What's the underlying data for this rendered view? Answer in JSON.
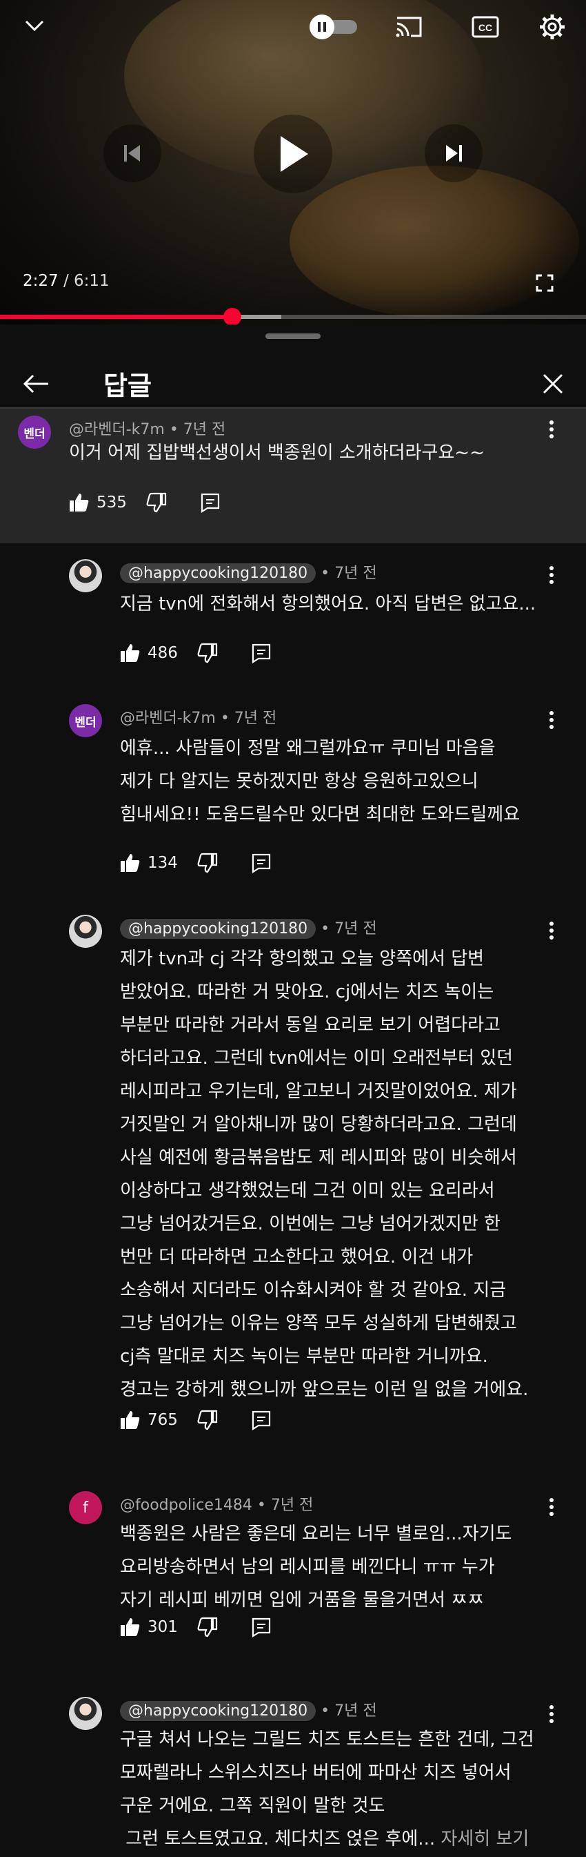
{
  "player": {
    "current_time": "2:27",
    "separator": " / ",
    "duration": "6:11",
    "progress_fraction": 0.397,
    "buffered_fraction": 0.48
  },
  "panel": {
    "title": "답글"
  },
  "parent_comment": {
    "avatar_text": "벤더",
    "author": "@라벤더-k7m",
    "time": "• 7년 전",
    "text": "이거 어제 집밥백선생이서 백종원이 소개하더라구요~~",
    "likes": "535"
  },
  "replies": [
    {
      "author": "@happycooking120180",
      "time": "• 7년 전",
      "lines": [
        "지금 tvn에 전화해서 항의했어요. 아직 답변은 없고요..."
      ],
      "likes": "486"
    },
    {
      "avatar_text": "벤더",
      "author": "@라벤더-k7m",
      "time": "• 7년 전",
      "lines": [
        "에휴... 사람들이 정말 왜그럴까요ㅠ  쿠미님 마음을",
        "제가 다 알지는 못하겠지만 항상 응원하고있으니",
        "힘내세요!! 도움드릴수만 있다면 최대한 도와드릴께요"
      ],
      "likes": "134"
    },
    {
      "author": "@happycooking120180",
      "time": "• 7년 전",
      "lines": [
        "제가 tvn과 cj 각각 항의했고 오늘 양쪽에서 답변",
        "받았어요. 따라한 거 맞아요. cj에서는 치즈 녹이는",
        "부분만 따라한 거라서 동일 요리로 보기 어렵다라고",
        "하더라고요. 그런데 tvn에서는 이미 오래전부터 있던",
        "레시피라고 우기는데, 알고보니 거짓말이었어요. 제가",
        "거짓말인 거 알아채니까 많이 당황하더라고요. 그런데",
        "사실 예전에 황금볶음밥도 제 레시피와 많이 비슷해서",
        "이상하다고 생각했었는데 그건 이미 있는 요리라서",
        "그냥 넘어갔거든요. 이번에는 그냥 넘어가겠지만 한",
        "번만 더 따라하면 고소한다고 했어요. 이건 내가",
        "소송해서 지더라도 이슈화시켜야 할 것 같아요. 지금",
        "그냥 넘어가는 이유는 양쪽 모두 성실하게 답변해줬고",
        "cj측 말대로 치즈 녹이는 부분만 따라한 거니까요.",
        "경고는 강하게 했으니까 앞으로는 이런 일 없을 거에요."
      ],
      "likes": "765"
    },
    {
      "avatar_text": "f",
      "author": "@foodpolice1484",
      "time": "• 7년 전",
      "lines": [
        "백종원은 사람은 좋은데 요리는 너무 별로임...자기도",
        "요리방송하면서 남의 레시피를 베낀다니 ㅠㅠ 누가",
        "자기 레시피 베끼면 입에 거품을 물을거면서 ㅉㅉ"
      ],
      "likes": "301"
    },
    {
      "author": "@happycooking120180",
      "time": "• 7년 전",
      "lines": [
        "구글 쳐서 나오는 그릴드 치즈 토스트는 흔한 건데, 그건",
        "모짜렐라나 스위스치즈나 버터에 파마산 치즈 넣어서",
        "구운 거에요. 그쪽 직원이 말한 것도",
        " 그런 토스트였고요. 체다치즈 얹은 후에..."
      ],
      "more": "자세히 보기"
    }
  ],
  "colors": {
    "accent": "#ff0033",
    "panel_bg": "#0f0f0f",
    "parent_bg": "#272727"
  }
}
